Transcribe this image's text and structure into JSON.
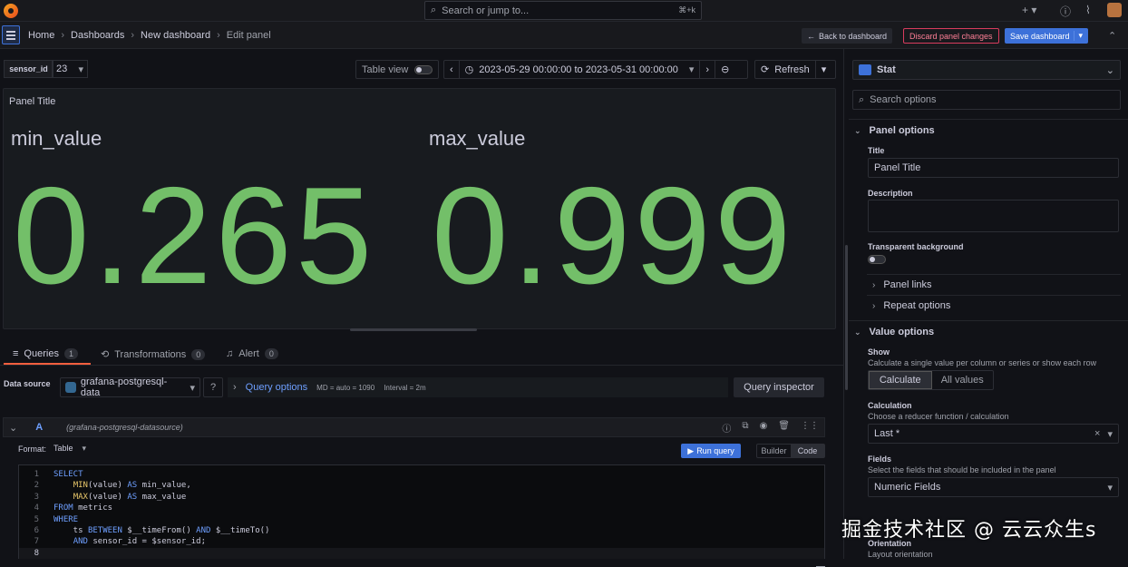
{
  "topbar": {
    "search_placeholder": "Search or jump to...",
    "search_shortcut": "⌘+k",
    "plus_icon": "+",
    "help_icon": "?",
    "rss_icon": "rss"
  },
  "breadcrumb": [
    "Home",
    "Dashboards",
    "New dashboard",
    "Edit panel"
  ],
  "nav": {
    "back_label": "Back to dashboard",
    "discard_label": "Discard panel changes",
    "save_label": "Save dashboard"
  },
  "variables": {
    "label": "sensor_id",
    "value": "23"
  },
  "toolbar": {
    "table_view_label": "Table view",
    "time_range": "2023-05-29 00:00:00 to 2023-05-31 00:00:00",
    "refresh_label": "Refresh"
  },
  "panel": {
    "title": "Panel Title",
    "stats": [
      {
        "name": "min_value",
        "value": "0.265"
      },
      {
        "name": "max_value",
        "value": "0.999"
      }
    ],
    "stat_color": "#73bf69"
  },
  "query_tabs": [
    {
      "label": "Queries",
      "count": "1"
    },
    {
      "label": "Transformations",
      "count": "0"
    },
    {
      "label": "Alert",
      "count": "0"
    }
  ],
  "datasource": {
    "label": "Data source",
    "value": "grafana-postgresql-data",
    "query_options_label": "Query options",
    "md": "MD = auto = 1090",
    "interval": "Interval = 2m",
    "inspector_label": "Query inspector"
  },
  "query": {
    "ref": "A",
    "ds_name": "(grafana-postgresql-datasource)",
    "format_label": "Format:",
    "format_value": "Table",
    "run_label": "Run query",
    "builder_label": "Builder",
    "code_label": "Code",
    "lines": [
      {
        "no": "1",
        "code": "SELECT"
      },
      {
        "no": "2",
        "code": "    MIN(value) AS min_value,"
      },
      {
        "no": "3",
        "code": "    MAX(value) AS max_value"
      },
      {
        "no": "4",
        "code": "FROM metrics"
      },
      {
        "no": "5",
        "code": "WHERE"
      },
      {
        "no": "6",
        "code": "    ts BETWEEN $__timeFrom() AND $__timeTo()"
      },
      {
        "no": "7",
        "code": "    AND sensor_id = $sensor_id;"
      },
      {
        "no": "8",
        "code": ""
      }
    ]
  },
  "options": {
    "viz_name": "Stat",
    "search_placeholder": "Search options",
    "panel_options": "Panel options",
    "title_label": "Title",
    "title_value": "Panel Title",
    "description_label": "Description",
    "transparent_label": "Transparent background",
    "panel_links": "Panel links",
    "repeat_options": "Repeat options",
    "value_options": "Value options",
    "show_label": "Show",
    "show_desc": "Calculate a single value per column or series or show each row",
    "show_calculate": "Calculate",
    "show_all": "All values",
    "calc_label": "Calculation",
    "calc_desc": "Choose a reducer function / calculation",
    "calc_value": "Last *",
    "fields_label": "Fields",
    "fields_desc": "Select the fields that should be included in the panel",
    "fields_value": "Numeric Fields",
    "orientation_label": "Orientation",
    "orientation_desc": "Layout orientation"
  },
  "watermark": "掘金技术社区 @ 云云众生s",
  "colors": {
    "accent": "#3d71d9",
    "danger": "#d83c5e",
    "tab_active": "#f55f3e",
    "link": "#6e9fff"
  }
}
